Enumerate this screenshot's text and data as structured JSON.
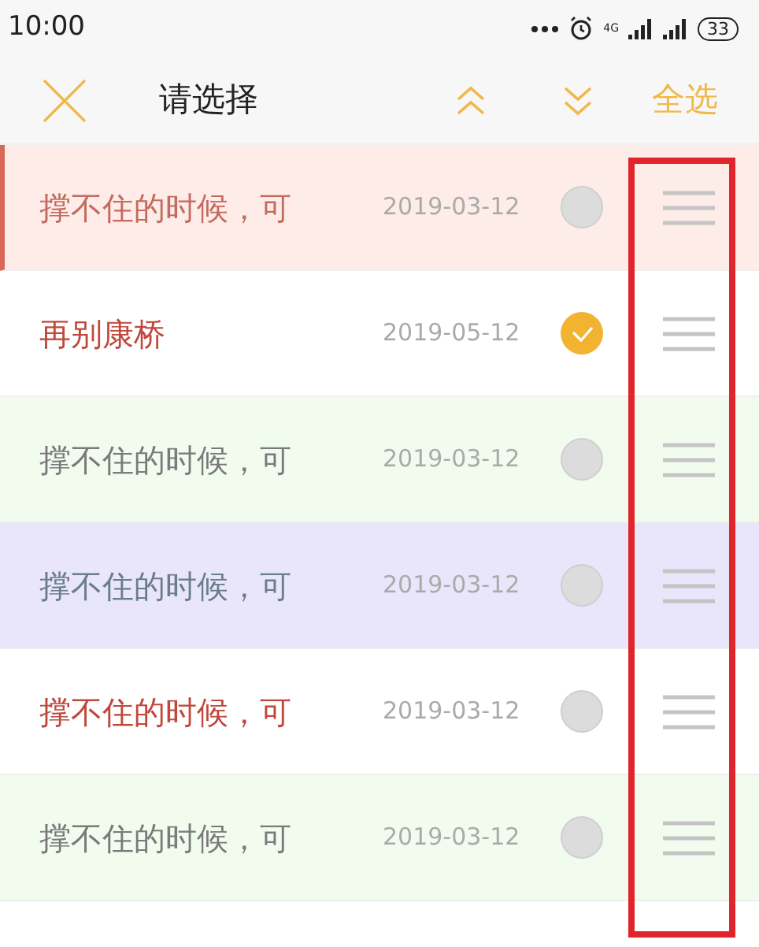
{
  "status_bar": {
    "time": "10:00",
    "network": "4G",
    "battery": "33"
  },
  "header": {
    "title": "请选择",
    "select_all": "全选"
  },
  "rows": [
    {
      "title": "撑不住的时候，可",
      "date": "2019-03-12",
      "selected": false,
      "highlighted": true,
      "color": "#fdece7",
      "kind": "salmon"
    },
    {
      "title": "再别康桥",
      "date": "2019-05-12",
      "selected": true,
      "highlighted": false,
      "color": "#ffffff",
      "kind": "red"
    },
    {
      "title": "撑不住的时候，可",
      "date": "2019-03-12",
      "selected": false,
      "highlighted": false,
      "color": "#f1fcef",
      "kind": "gray"
    },
    {
      "title": "撑不住的时候，可",
      "date": "2019-03-12",
      "selected": false,
      "highlighted": false,
      "color": "#e9e6fb",
      "kind": "slate"
    },
    {
      "title": "撑不住的时候，可",
      "date": "2019-03-12",
      "selected": false,
      "highlighted": false,
      "color": "#ffffff",
      "kind": "red"
    },
    {
      "title": "撑不住的时候，可",
      "date": "2019-03-12",
      "selected": false,
      "highlighted": false,
      "color": "#f1fcef",
      "kind": "gray"
    }
  ]
}
